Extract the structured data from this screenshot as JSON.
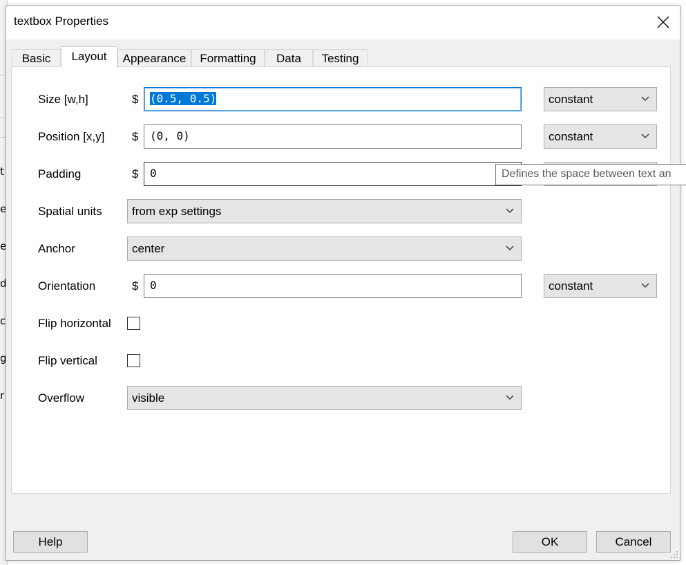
{
  "window": {
    "title": "textbox Properties"
  },
  "tabs": [
    {
      "label": "Basic"
    },
    {
      "label": "Layout",
      "active": true
    },
    {
      "label": "Appearance"
    },
    {
      "label": "Formatting"
    },
    {
      "label": "Data"
    },
    {
      "label": "Testing"
    }
  ],
  "fields": {
    "size": {
      "label": "Size [w,h]",
      "prefix": "$",
      "value": "(0.5, 0.5)",
      "mode": "constant"
    },
    "position": {
      "label": "Position [x,y]",
      "prefix": "$",
      "value": "(0, 0)",
      "mode": "constant"
    },
    "padding": {
      "label": "Padding",
      "prefix": "$",
      "value": "0"
    },
    "spatial_units": {
      "label": "Spatial units",
      "value": "from exp settings"
    },
    "anchor": {
      "label": "Anchor",
      "value": "center"
    },
    "orientation": {
      "label": "Orientation",
      "prefix": "$",
      "value": "0",
      "mode": "constant"
    },
    "flip_horizontal": {
      "label": "Flip horizontal",
      "checked": false
    },
    "flip_vertical": {
      "label": "Flip vertical",
      "checked": false
    },
    "overflow": {
      "label": "Overflow",
      "value": "visible"
    }
  },
  "tooltip": {
    "text": "Defines the space between text an"
  },
  "buttons": {
    "help": "Help",
    "ok": "OK",
    "cancel": "Cancel"
  },
  "background_fragments": [
    "t",
    "e",
    "e",
    "d",
    "c",
    "g",
    "r"
  ],
  "colors": {
    "accent": "#0078d7",
    "selection_text": "#ffffff",
    "button_face": "#e1e1e1",
    "combo_face": "#e5e5e5"
  }
}
